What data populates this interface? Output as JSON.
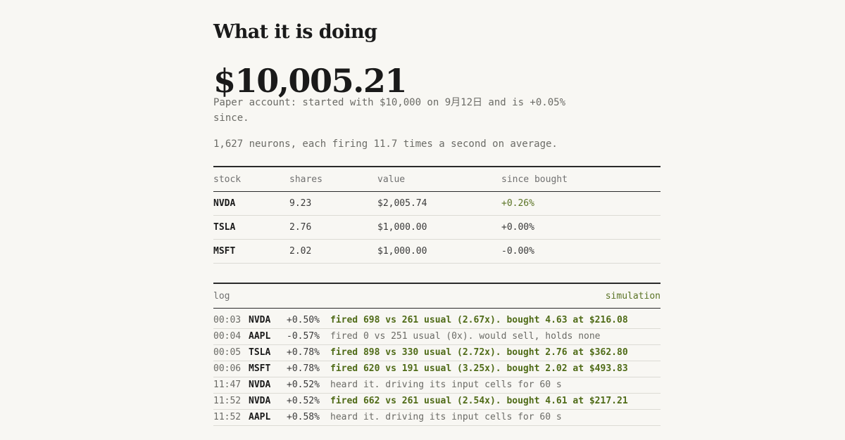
{
  "section_title": "What it is doing",
  "balance": "$10,005.21",
  "summary": "Paper account: started with $10,000 on 9月12日 and is +0.05% since.",
  "neurons_line": "1,627 neurons, each firing 11.7 times a second on average.",
  "colors": {
    "background": "#f8f7f3",
    "positive": "#5a7324",
    "fired": "#4f6b17",
    "muted": "#6b6b66"
  },
  "holdings": {
    "headers": [
      "stock",
      "shares",
      "value",
      "since bought"
    ],
    "rows": [
      {
        "stock": "NVDA",
        "shares": "9.23",
        "value": "$2,005.74",
        "since": "+0.26%",
        "positive": true
      },
      {
        "stock": "TSLA",
        "shares": "2.76",
        "value": "$1,000.00",
        "since": "+0.00%",
        "positive": false
      },
      {
        "stock": "MSFT",
        "shares": "2.02",
        "value": "$1,000.00",
        "since": "-0.00%",
        "positive": false
      }
    ]
  },
  "log": {
    "title": "log",
    "mode": "simulation",
    "entries": [
      {
        "time": "00:03",
        "symbol": "NVDA",
        "change": "+0.50%",
        "message": "fired 698 vs 261 usual (2.67x). bought 4.63 at $216.08",
        "fired": true
      },
      {
        "time": "00:04",
        "symbol": "AAPL",
        "change": "-0.57%",
        "message": "fired 0 vs 251 usual (0x). would sell, holds none",
        "fired": false
      },
      {
        "time": "00:05",
        "symbol": "TSLA",
        "change": "+0.78%",
        "message": "fired 898 vs 330 usual (2.72x). bought 2.76 at $362.80",
        "fired": true
      },
      {
        "time": "00:06",
        "symbol": "MSFT",
        "change": "+0.78%",
        "message": "fired 620 vs 191 usual (3.25x). bought 2.02 at $493.83",
        "fired": true
      },
      {
        "time": "11:47",
        "symbol": "NVDA",
        "change": "+0.52%",
        "message": "heard it. driving its input cells for 60 s",
        "fired": false
      },
      {
        "time": "11:52",
        "symbol": "NVDA",
        "change": "+0.52%",
        "message": "fired 662 vs 261 usual (2.54x). bought 4.61 at $217.21",
        "fired": true
      },
      {
        "time": "11:52",
        "symbol": "AAPL",
        "change": "+0.58%",
        "message": "heard it. driving its input cells for 60 s",
        "fired": false
      }
    ]
  }
}
